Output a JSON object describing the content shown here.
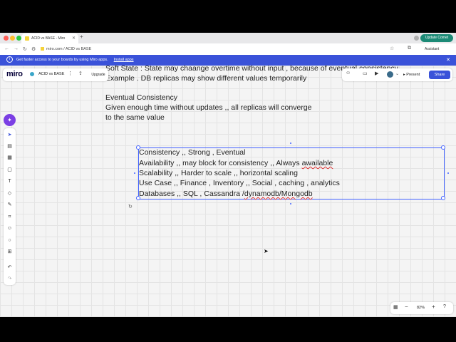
{
  "browser": {
    "tab_title": "ACID vs BASE - Miro",
    "new_tab_symbol": "+",
    "url": "miro.com / ACID vs BASE",
    "update_button": "Update Comet",
    "assistant_label": "Assistant"
  },
  "banner": {
    "message": "Get faster access to your boards by using Miro apps.",
    "install_label": "Install apps"
  },
  "miro": {
    "logo": "miro",
    "board_name": "ACID vs BASE",
    "upgrade_label": "Upgrade",
    "present_label": "Present",
    "share_label": "Share",
    "zoom_level": "82%"
  },
  "board": {
    "soft_state_line1": "Soft State : State may chaange overtime without input , because of eventual consistency",
    "soft_state_line2": "Example . DB replicas may show different values temporarily",
    "eventual_title": "Eventual Consistency",
    "eventual_line1": "Given enough time without updates ,, all replicas will converge",
    "eventual_line2": "to the same value",
    "selected_lines": [
      "Consistency ,, Strong , Eventual",
      "Availability ,, may block for consistency ,, Always ",
      "Scalability ,, Harder to scale ,, horizontal scaling",
      "Use Case ,, Finance , Inventory ,, Social , caching , analytics",
      "Databases ,, SQL ,  Cassandra /"
    ],
    "misspelled_1": "awailable",
    "misspelled_2": "dynamodb/Mongodb"
  },
  "colors": {
    "accent": "#4262ff",
    "banner": "#3a52d9",
    "update_button": "#1c8a76"
  }
}
